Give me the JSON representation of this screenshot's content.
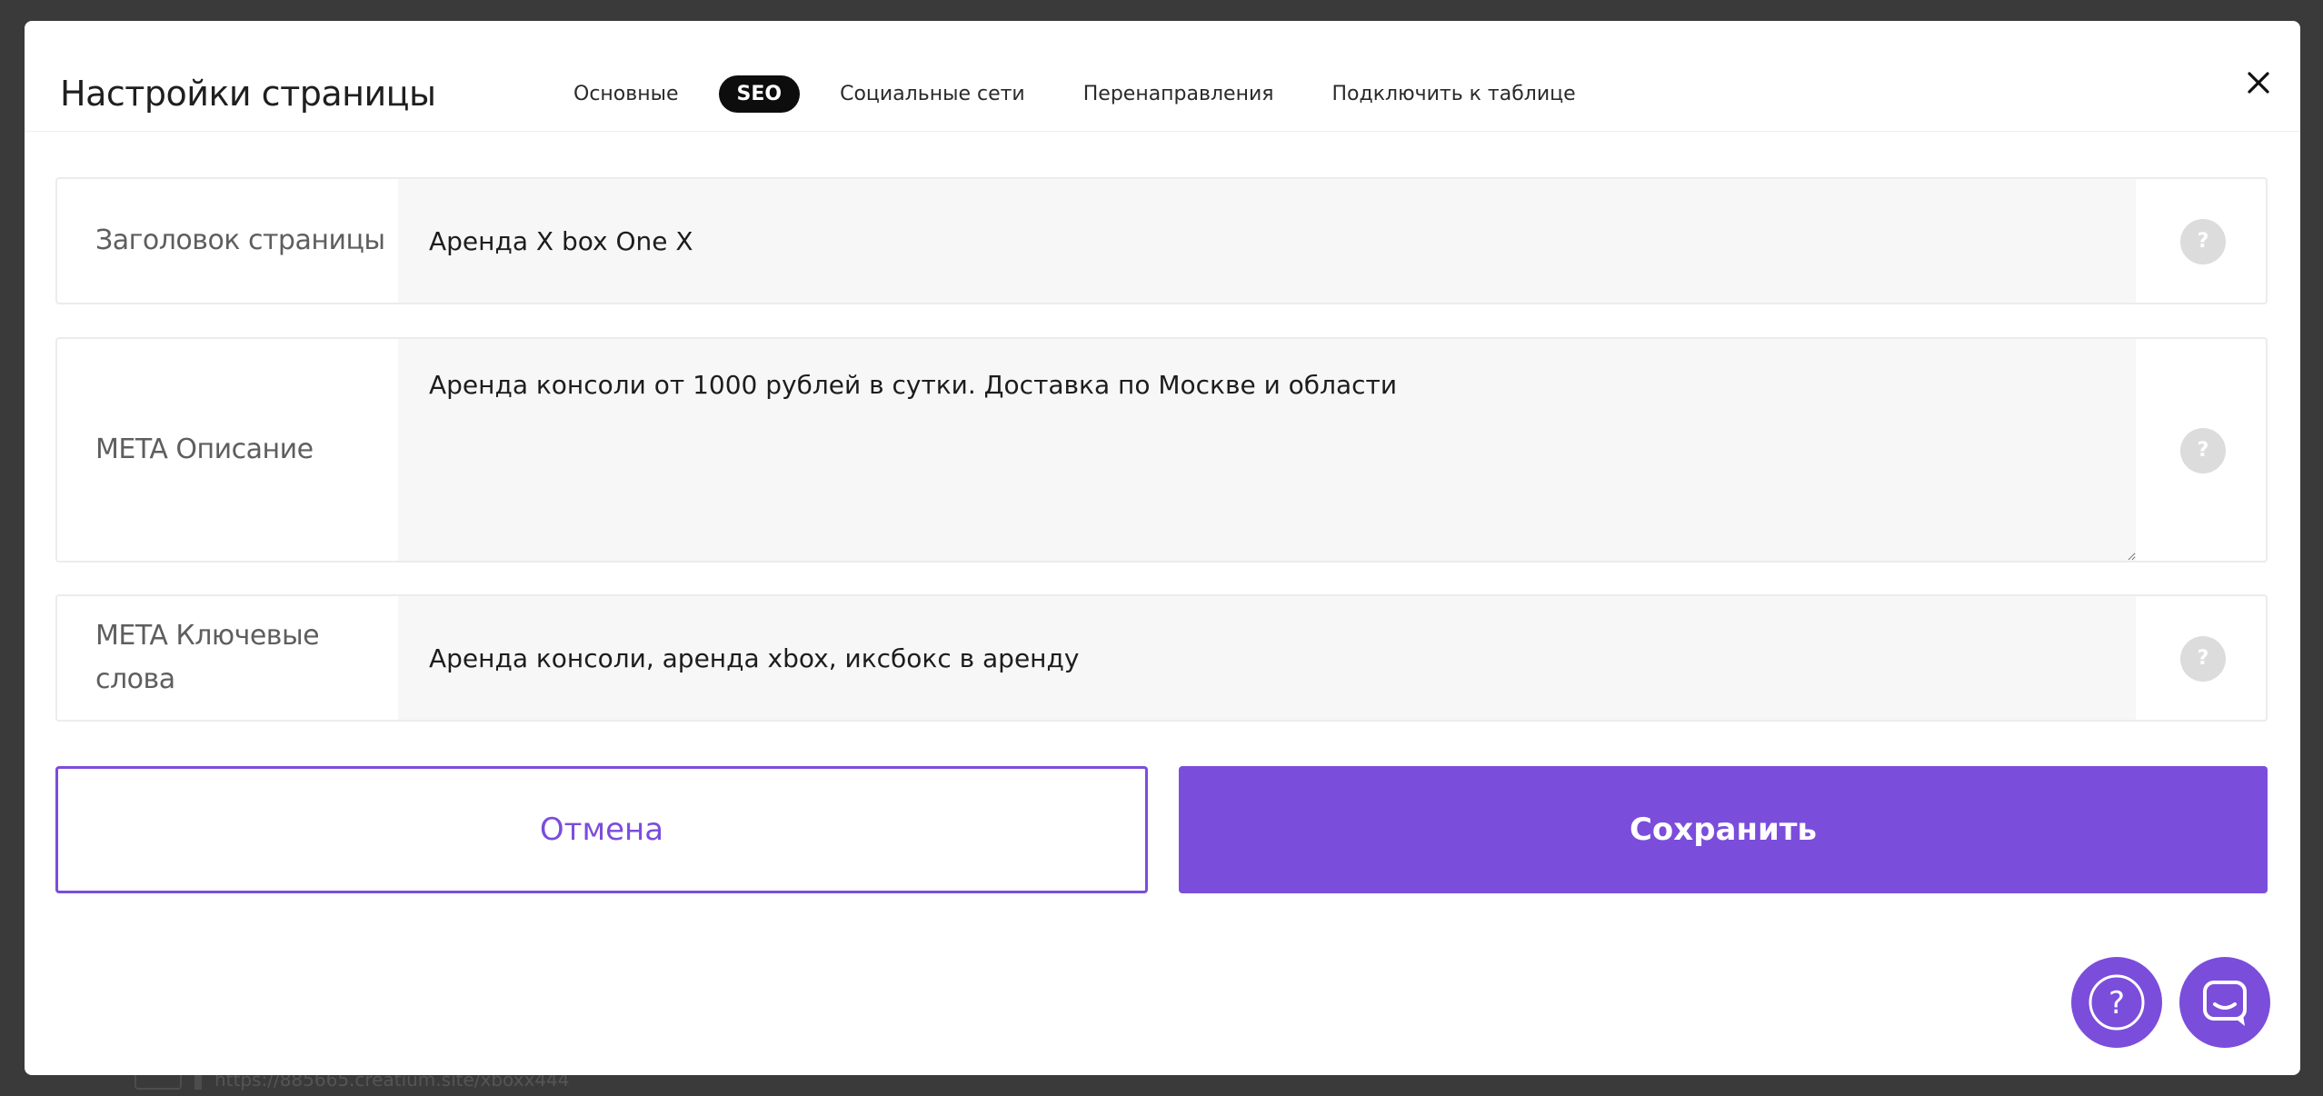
{
  "backdrop": {
    "url": "https://885665.creatium.site/xboxx444"
  },
  "modal": {
    "title": "Настройки страницы",
    "tabs": [
      {
        "label": "Основные",
        "active": false
      },
      {
        "label": "SEO",
        "active": true
      },
      {
        "label": "Социальные сети",
        "active": false
      },
      {
        "label": "Перенаправления",
        "active": false
      },
      {
        "label": "Подключить к таблице",
        "active": false
      }
    ],
    "close_icon": "close-icon"
  },
  "fields": {
    "page_title": {
      "label": "Заголовок страницы",
      "value": "Аренда X box One X"
    },
    "meta_description": {
      "label": "META Описание",
      "value": "Аренда консоли от 1000 рублей в сутки. Доставка по Москве и области"
    },
    "meta_keywords": {
      "label_line1": "META Ключевые",
      "label_line2": "слова",
      "value": "Аренда консоли, аренда xbox, иксбокс в аренду"
    },
    "help_glyph": "?"
  },
  "actions": {
    "cancel_label": "Отмена",
    "save_label": "Сохранить"
  },
  "widgets": {
    "help_glyph": "?",
    "chat_icon": "chat-icon"
  },
  "colors": {
    "accent": "#7b4ddb",
    "active_tab_bg": "#0d0d0d",
    "input_bg": "#f7f7f7",
    "help_bg": "#dcdcdc"
  }
}
